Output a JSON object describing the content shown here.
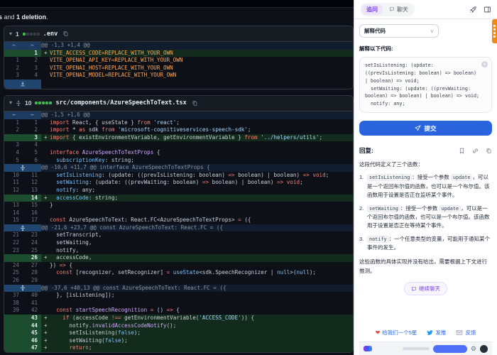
{
  "left": {
    "summary_parts": [
      {
        "b": true,
        "t": "s"
      },
      {
        "b": false,
        "t": " and "
      },
      {
        "b": true,
        "t": "1 deletion"
      },
      {
        "b": false,
        "t": "."
      }
    ],
    "files": [
      {
        "name": ".env",
        "count": "1",
        "squares": [
          "g",
          "n",
          "n",
          "n",
          "n"
        ],
        "unfold_header": false,
        "rows": [
          {
            "type": "hunk1",
            "text": "@@ -1,3 +1,4 @@"
          },
          {
            "type": "add",
            "new": "1",
            "segs": [
              [
                "o",
                "VITE_ACCESS_CODE=REPLACE_WITH_YOUR_OWN"
              ]
            ]
          },
          {
            "type": "ctx",
            "old": "1",
            "new": "2",
            "segs": [
              [
                "o",
                "VITE_OPENAI_API_KEY=REPLACE_WITH_YOUR_OWN"
              ]
            ]
          },
          {
            "type": "ctx",
            "old": "2",
            "new": "3",
            "segs": [
              [
                "o",
                "VITE_OPENAI_HOST=REPLACE_WITH_YOUR_OWN"
              ]
            ]
          },
          {
            "type": "ctx",
            "old": "3",
            "new": "4",
            "segs": [
              [
                "o",
                "VITE_OPENAI_MODEL=REPLACE_WITH_YOUR_OWN"
              ]
            ]
          },
          {
            "type": "expand"
          }
        ]
      },
      {
        "name": "src/components/AzureSpeechToText.tsx",
        "count": "10",
        "squares": [
          "g",
          "g",
          "g",
          "g",
          "g"
        ],
        "unfold_header": true,
        "rows": [
          {
            "type": "hunk1",
            "text": "@@ -1,5 +1,6 @@"
          },
          {
            "type": "ctx",
            "old": "1",
            "new": "1",
            "segs": [
              [
                "k",
                "import"
              ],
              [
                "p",
                " React, { useState } "
              ],
              [
                "k",
                "from"
              ],
              [
                "s",
                " 'react'"
              ],
              [
                "p",
                ";"
              ]
            ]
          },
          {
            "type": "ctx",
            "old": "2",
            "new": "2",
            "segs": [
              [
                "k",
                "import"
              ],
              [
                "p",
                " * "
              ],
              [
                "k",
                "as"
              ],
              [
                "p",
                " sdk "
              ],
              [
                "k",
                "from"
              ],
              [
                "s",
                " 'microsoft-cognitiveservices-speech-sdk'"
              ],
              [
                "p",
                ";"
              ]
            ]
          },
          {
            "type": "add",
            "new": "3",
            "segs": [
              [
                "k",
                "import"
              ],
              [
                "p",
                " { existEnvironmentVariable, getEnvironmentVariable } "
              ],
              [
                "k",
                "from"
              ],
              [
                "s",
                " '../helpers/utils'"
              ],
              [
                "p",
                ";"
              ]
            ]
          },
          {
            "type": "ctx",
            "old": "3",
            "new": "4",
            "segs": []
          },
          {
            "type": "ctx",
            "old": "4",
            "new": "5",
            "segs": [
              [
                "k",
                "interface"
              ],
              [
                "f",
                " AzureSpeechToTextProps"
              ],
              [
                "p",
                " {"
              ]
            ]
          },
          {
            "type": "ctx",
            "old": "5",
            "new": "6",
            "segs": [
              [
                "c",
                "  subscriptionKey"
              ],
              [
                "p",
                ": string;"
              ]
            ]
          },
          {
            "type": "hunkmid",
            "text": "@@ -10,6 +11,7 @@ interface AzureSpeechToTextProps {"
          },
          {
            "type": "ctx",
            "old": "10",
            "new": "11",
            "segs": [
              [
                "c",
                "  setIsListening"
              ],
              [
                "p",
                ": (update: ((prevIsListening: boolean) "
              ],
              [
                "k",
                "=>"
              ],
              [
                "p",
                " boolean) | boolean) "
              ],
              [
                "k",
                "=>"
              ],
              [
                "p",
                " "
              ],
              [
                "k",
                "void"
              ],
              [
                "p",
                ";"
              ]
            ]
          },
          {
            "type": "ctx",
            "old": "11",
            "new": "12",
            "segs": [
              [
                "c",
                "  setWaiting"
              ],
              [
                "p",
                ": (update: ((prevWaiting: boolean) "
              ],
              [
                "k",
                "=>"
              ],
              [
                "p",
                " boolean) | boolean) "
              ],
              [
                "k",
                "=>"
              ],
              [
                "p",
                " "
              ],
              [
                "k",
                "void"
              ],
              [
                "p",
                ";"
              ]
            ]
          },
          {
            "type": "ctx",
            "old": "12",
            "new": "13",
            "segs": [
              [
                "c",
                "  notify"
              ],
              [
                "p",
                ": any;"
              ]
            ]
          },
          {
            "type": "add",
            "new": "14",
            "segs": [
              [
                "c",
                "  accessCode"
              ],
              [
                "p",
                ": string;"
              ]
            ]
          },
          {
            "type": "ctx",
            "old": "13",
            "new": "15",
            "segs": [
              [
                "p",
                "}"
              ]
            ]
          },
          {
            "type": "ctx",
            "old": "14",
            "new": "16",
            "segs": []
          },
          {
            "type": "ctx",
            "old": "15",
            "new": "17",
            "segs": [
              [
                "k",
                "const"
              ],
              [
                "p",
                " AzureSpeechToText: React.FC<AzureSpeechToTextProps> "
              ],
              [
                "k",
                "="
              ],
              [
                "p",
                " ({"
              ]
            ]
          },
          {
            "type": "hunkmid",
            "text": "@@ -21,6 +23,7 @@ const AzureSpeechToText: React.FC<AzureSpeechToTextProps> = ({"
          },
          {
            "type": "ctx",
            "old": "21",
            "new": "23",
            "segs": [
              [
                "p",
                "  setTranscript,"
              ]
            ]
          },
          {
            "type": "ctx",
            "old": "22",
            "new": "24",
            "segs": [
              [
                "p",
                "  setWaiting,"
              ]
            ]
          },
          {
            "type": "ctx",
            "old": "23",
            "new": "25",
            "segs": [
              [
                "p",
                "  notify,"
              ]
            ]
          },
          {
            "type": "add",
            "new": "26",
            "segs": [
              [
                "p",
                "  accessCode,"
              ]
            ]
          },
          {
            "type": "ctx",
            "old": "24",
            "new": "27",
            "segs": [
              [
                "p",
                "}) "
              ],
              [
                "k",
                "=>"
              ],
              [
                "p",
                " {"
              ]
            ]
          },
          {
            "type": "ctx",
            "old": "25",
            "new": "28",
            "segs": [
              [
                "p",
                "  "
              ],
              [
                "k",
                "const"
              ],
              [
                "p",
                " [recognizer, setRecognizer] "
              ],
              [
                "k",
                "="
              ],
              [
                "p",
                " "
              ],
              [
                "c",
                "useState"
              ],
              [
                "p",
                "<sdk.SpeechRecognizer | "
              ],
              [
                "c",
                "null"
              ],
              [
                "p",
                ">("
              ],
              [
                "c",
                "null"
              ],
              [
                "p",
                ");"
              ]
            ]
          },
          {
            "type": "ctx",
            "old": "26",
            "new": "29",
            "segs": []
          },
          {
            "type": "hunkmid",
            "text": "@@ -37,6 +40,13 @@ const AzureSpeechToText: React.FC<AzureSpeechToTextProps> = ({"
          },
          {
            "type": "ctx",
            "old": "37",
            "new": "40",
            "segs": [
              [
                "p",
                "  }, [isListening]);"
              ]
            ]
          },
          {
            "type": "ctx",
            "old": "38",
            "new": "41",
            "segs": []
          },
          {
            "type": "ctx",
            "old": "39",
            "new": "42",
            "segs": [
              [
                "p",
                "  "
              ],
              [
                "k",
                "const"
              ],
              [
                "p",
                " "
              ],
              [
                "f",
                "startSpeechRecognition"
              ],
              [
                "p",
                " "
              ],
              [
                "k",
                "="
              ],
              [
                "p",
                " () "
              ],
              [
                "k",
                "=>"
              ],
              [
                "p",
                " {"
              ]
            ]
          },
          {
            "type": "add",
            "new": "43",
            "segs": [
              [
                "p",
                "    "
              ],
              [
                "k",
                "if"
              ],
              [
                "p",
                " (accessCode "
              ],
              [
                "k",
                "!=="
              ],
              [
                "p",
                " getEnvironmentVariable("
              ],
              [
                "s",
                "'ACCESS_CODE'"
              ],
              [
                "p",
                ")) {"
              ]
            ]
          },
          {
            "type": "add",
            "new": "44",
            "segs": [
              [
                "p",
                "      notify."
              ],
              [
                "f",
                "invalidAccessCodeNotify"
              ],
              [
                "p",
                "();"
              ]
            ]
          },
          {
            "type": "add",
            "new": "45",
            "segs": [
              [
                "p",
                "      setIsListening("
              ],
              [
                "c",
                "false"
              ],
              [
                "p",
                ");"
              ]
            ]
          },
          {
            "type": "add",
            "new": "46",
            "segs": [
              [
                "p",
                "      setWaiting("
              ],
              [
                "c",
                "false"
              ],
              [
                "p",
                ");"
              ]
            ]
          },
          {
            "type": "add",
            "new": "47",
            "segs": [
              [
                "p",
                "      "
              ],
              [
                "k",
                "return"
              ],
              [
                "p",
                ";"
              ]
            ]
          }
        ]
      }
    ]
  },
  "panel": {
    "tabs": [
      {
        "label": "追问",
        "active": true
      },
      {
        "label": "聊天",
        "active": false
      }
    ],
    "prompt_select": "解释代码",
    "prompt_label": "解释以下代码:",
    "code_snippet": "setIsListening: (update: ((prevIsListening: boolean) => boolean) | boolean) => void;\n  setWaiting: (update: ((prevWaiting: boolean) => boolean) | boolean) => void;\n  notify: any;",
    "submit_label": "提交",
    "reply_label": "回复:",
    "reply_intro": "这段代码定义了三个函数：",
    "reply_items": [
      {
        "num": "1.",
        "parts": [
          {
            "c": true,
            "t": "setIsListening"
          },
          {
            "c": false,
            "t": "：接受一个参数 "
          },
          {
            "c": true,
            "t": "update"
          },
          {
            "c": false,
            "t": "，可以是一个返回布尔值的函数，也可以是一个布尔值。该函数用于设置是否正在监听某个事件。"
          }
        ]
      },
      {
        "num": "2.",
        "parts": [
          {
            "c": true,
            "t": "setWaiting"
          },
          {
            "c": false,
            "t": "：接受一个参数 "
          },
          {
            "c": true,
            "t": "update"
          },
          {
            "c": false,
            "t": "，可以是一个返回布尔值的函数，也可以是一个布尔值。该函数用于设置是否正在等待某个事件。"
          }
        ]
      },
      {
        "num": "3.",
        "parts": [
          {
            "c": true,
            "t": "notify"
          },
          {
            "c": false,
            "t": "：一个任意类型的变量，可能用于通知某个事件的发生。"
          }
        ]
      }
    ],
    "reply_note": "这些函数的具体实现并没有给出，需要根据上下文进行推测。",
    "continue_label": "继续聊天",
    "footer_links": [
      {
        "icon": "heart",
        "label": "给我们一个5星"
      },
      {
        "icon": "twitter",
        "label": "发推"
      },
      {
        "icon": "mail",
        "label": "反馈"
      }
    ]
  },
  "colors": {
    "accent_blue": "#2964dd",
    "accent_purple": "#7c3aed",
    "diff_green": "#3fb950",
    "ribbon_orange": "#ee8a1d"
  }
}
